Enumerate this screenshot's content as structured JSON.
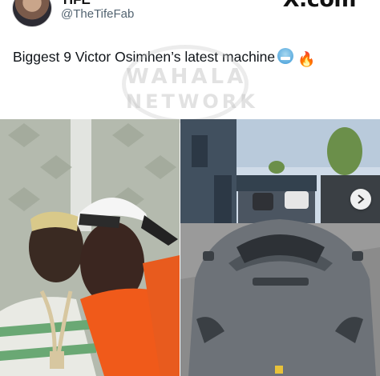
{
  "post": {
    "display_name": "TIFE",
    "handle": "@TheTifeFab",
    "platform_logo": "X.com",
    "text": "Biggest 9 Victor Osimhen’s latest machine",
    "emojis": [
      "cold-face-emoji",
      "fire-emoji"
    ]
  },
  "watermark": {
    "line1": "WAHALA",
    "line2": "NETWORK"
  },
  "images": {
    "left": "two-men-selfie-photo",
    "right": "grey-sports-car-photo"
  },
  "icons": {
    "next": "chevron-right-icon"
  },
  "colors": {
    "handle": "#536471",
    "text": "#0f1419"
  }
}
